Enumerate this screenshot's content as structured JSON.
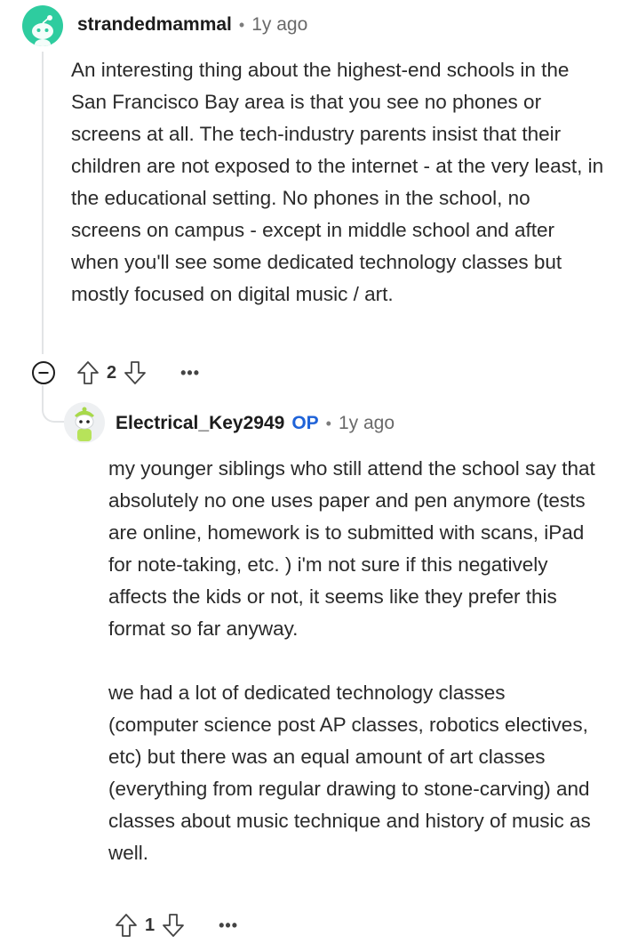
{
  "comment1": {
    "username": "strandedmammal",
    "age": "1y ago",
    "body": "An interesting thing about the highest-end schools in the San Francisco Bay area is that you see no phones or screens at all. The tech-industry parents insist that their children are not exposed to the internet - at the very least, in the educational setting. No phones in the school, no screens on campus - except in middle school and after when you'll see some dedicated technology classes but mostly focused on digital music / art.",
    "votes": "2",
    "more": "•••"
  },
  "comment2": {
    "username": "Electrical_Key2949",
    "badge": "OP",
    "age": "1y ago",
    "paragraph1": "my younger siblings who still attend the school say that absolutely no one uses paper and pen anymore (tests are online, homework is to submitted with scans, iPad for note-taking, etc. ) i'm not sure if this negatively affects the kids or not, it seems like they prefer this format so far anyway.",
    "paragraph2": "we had a lot of dedicated technology classes (computer science post AP classes, robotics electives, etc) but there was an equal amount of art classes (everything from regular drawing to stone-carving) and classes about music technique and history of music as well.",
    "votes": "1",
    "more": "•••"
  },
  "separator": "•",
  "colors": {
    "accent_avatar": "#2ecc9f",
    "op_badge": "#1f63d8",
    "thread_line": "#e2e4e6"
  }
}
